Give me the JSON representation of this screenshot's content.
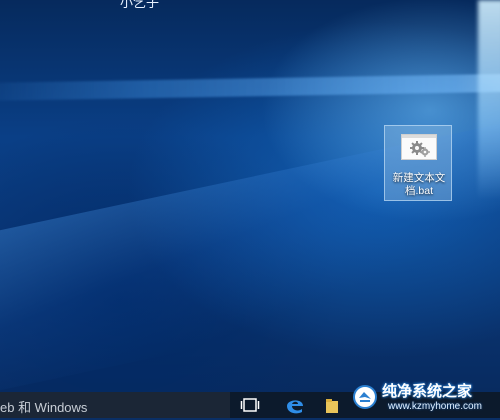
{
  "desktop": {
    "top_text": "小乞子",
    "icon": {
      "label": "新建文本文档.bat",
      "icon_name": "batch-file-gear-icon"
    }
  },
  "taskbar": {
    "search_text": "eb 和 Windows",
    "icons": [
      "task-view-icon",
      "edge-icon",
      "file-explorer-icon"
    ]
  },
  "watermark": {
    "title": "纯净系统之家",
    "url": "www.kzmyhome.com"
  },
  "colors": {
    "desktop_blue": "#0a3f86",
    "taskbar": "#0c1a2c",
    "edge_blue": "#2f8ee8"
  }
}
